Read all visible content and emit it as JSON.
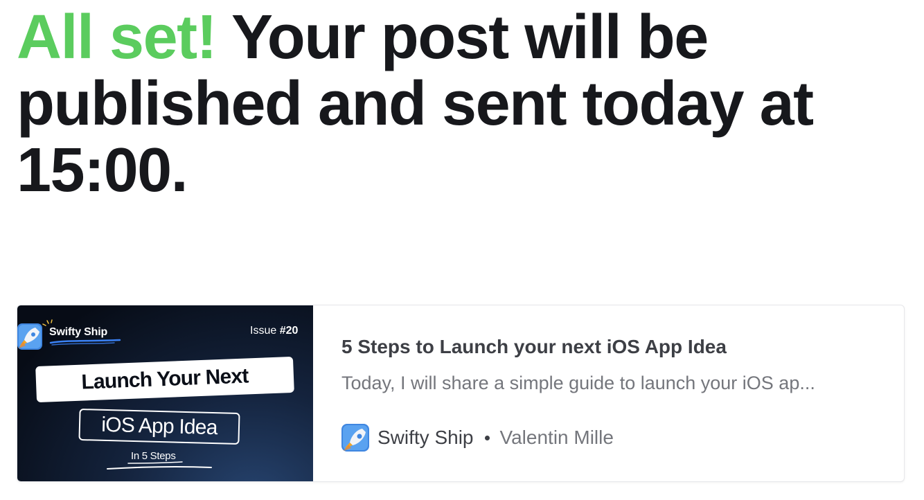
{
  "headline": {
    "accent": "All set!",
    "text": " Your post will be published and sent today at 15:00."
  },
  "colors": {
    "accent": "#5bcc5e",
    "headline": "#17181c",
    "title": "#3d3f45",
    "muted": "#74767c"
  },
  "post_card": {
    "thumbnail": {
      "brand": "Swifty Ship",
      "issue_prefix": "Issue ",
      "issue_number": "#20",
      "line1": "Launch Your Next",
      "line2": "iOS App Idea",
      "line3": "In 5 Steps",
      "icon": "rocket-icon"
    },
    "title": "5 Steps to Launch your next iOS App Idea",
    "description": "Today, I will share a simple guide to launch your iOS ap...",
    "publication": "Swifty Ship",
    "author": "Valentin Mille",
    "publication_icon": "rocket-icon"
  }
}
